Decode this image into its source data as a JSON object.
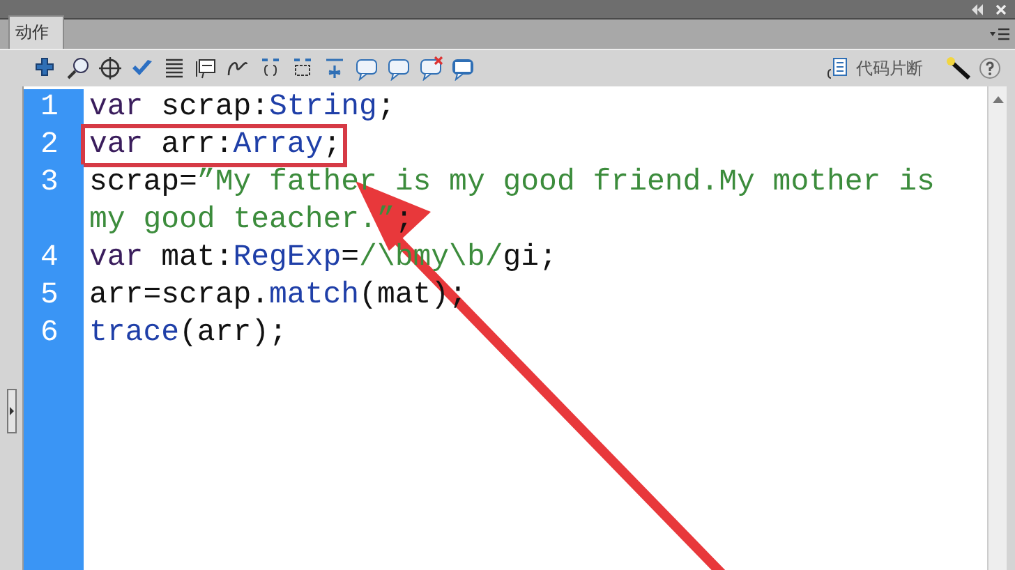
{
  "panel": {
    "tab": {
      "label": "动作",
      "selected": true
    }
  },
  "toolbar": {
    "snippets_label": "代码片断"
  },
  "code": {
    "lines": [
      {
        "number": "1",
        "highlighted": false,
        "tokens": [
          {
            "kind": "keyword",
            "text": "var "
          },
          {
            "kind": "plain",
            "text": "scrap:"
          },
          {
            "kind": "type",
            "text": "String"
          },
          {
            "kind": "plain",
            "text": ";"
          }
        ]
      },
      {
        "number": "2",
        "highlighted": true,
        "tokens": [
          {
            "kind": "keyword",
            "text": "var "
          },
          {
            "kind": "plain",
            "text": "arr:"
          },
          {
            "kind": "type",
            "text": "Array"
          },
          {
            "kind": "plain",
            "text": ";"
          }
        ]
      },
      {
        "number": "3",
        "highlighted": false,
        "tokens": [
          {
            "kind": "plain",
            "text": "scrap="
          },
          {
            "kind": "string",
            "text": "”My father is my good friend.My mother is my good teacher.”"
          },
          {
            "kind": "plain",
            "text": ";"
          }
        ]
      },
      {
        "number": "4",
        "highlighted": false,
        "tokens": [
          {
            "kind": "keyword",
            "text": "var "
          },
          {
            "kind": "plain",
            "text": "mat:"
          },
          {
            "kind": "type",
            "text": "RegExp"
          },
          {
            "kind": "plain",
            "text": "="
          },
          {
            "kind": "string",
            "text": "/\\bmy\\b/"
          },
          {
            "kind": "plain",
            "text": "gi;"
          }
        ]
      },
      {
        "number": "5",
        "highlighted": false,
        "tokens": [
          {
            "kind": "plain",
            "text": "arr=scrap."
          },
          {
            "kind": "type",
            "text": "match"
          },
          {
            "kind": "plain",
            "text": "(mat);"
          }
        ]
      },
      {
        "number": "6",
        "highlighted": false,
        "tokens": [
          {
            "kind": "type",
            "text": "trace"
          },
          {
            "kind": "plain",
            "text": "(arr);"
          }
        ]
      }
    ]
  }
}
